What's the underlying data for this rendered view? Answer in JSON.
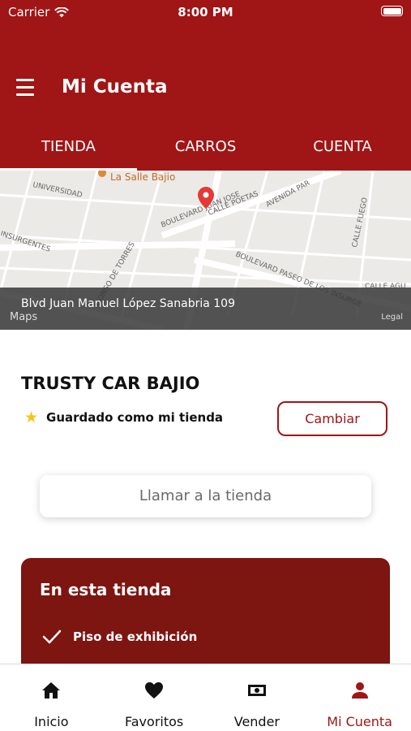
{
  "status_bar": {
    "carrier": "Carrier",
    "time": "8:00 PM"
  },
  "header": {
    "title": "Mi Cuenta"
  },
  "tabs": [
    {
      "label": "TIENDA",
      "active": true
    },
    {
      "label": "CARROS",
      "active": false
    },
    {
      "label": "CUENTA",
      "active": false
    }
  ],
  "map": {
    "address": "Blvd Juan Manuel López Sanabria 109",
    "logo": "Maps",
    "legal": "Legal",
    "poi": "La Salle Bajio",
    "streets": [
      "UNIVERSIDAD",
      "BOULEVARD JUAN JOSE",
      "CALLE POETAS",
      "AVENIDA PAR",
      "CALLE FUEGO",
      "INSURGENTES",
      "ALONSO DE TORRES",
      "BOULEVARD PASEO DE LOS INSURGE",
      "CALLE AGU"
    ]
  },
  "store": {
    "name": "TRUSTY CAR BAJIO",
    "saved_label": "Guardado como mi tienda",
    "change_label": "Cambiar",
    "call_label": "Llamar a la tienda"
  },
  "features": {
    "title": "En esta tienda",
    "items": [
      "Piso de exhibición"
    ]
  },
  "tabbar": [
    {
      "label": "Inicio",
      "icon": "home-icon",
      "active": false
    },
    {
      "label": "Favoritos",
      "icon": "heart-icon",
      "active": false
    },
    {
      "label": "Vender",
      "icon": "money-icon",
      "active": false
    },
    {
      "label": "Mi Cuenta",
      "icon": "user-icon",
      "active": true
    }
  ],
  "colors": {
    "primary": "#a01515",
    "features_bg": "#7d1510",
    "star": "#f5c518"
  }
}
